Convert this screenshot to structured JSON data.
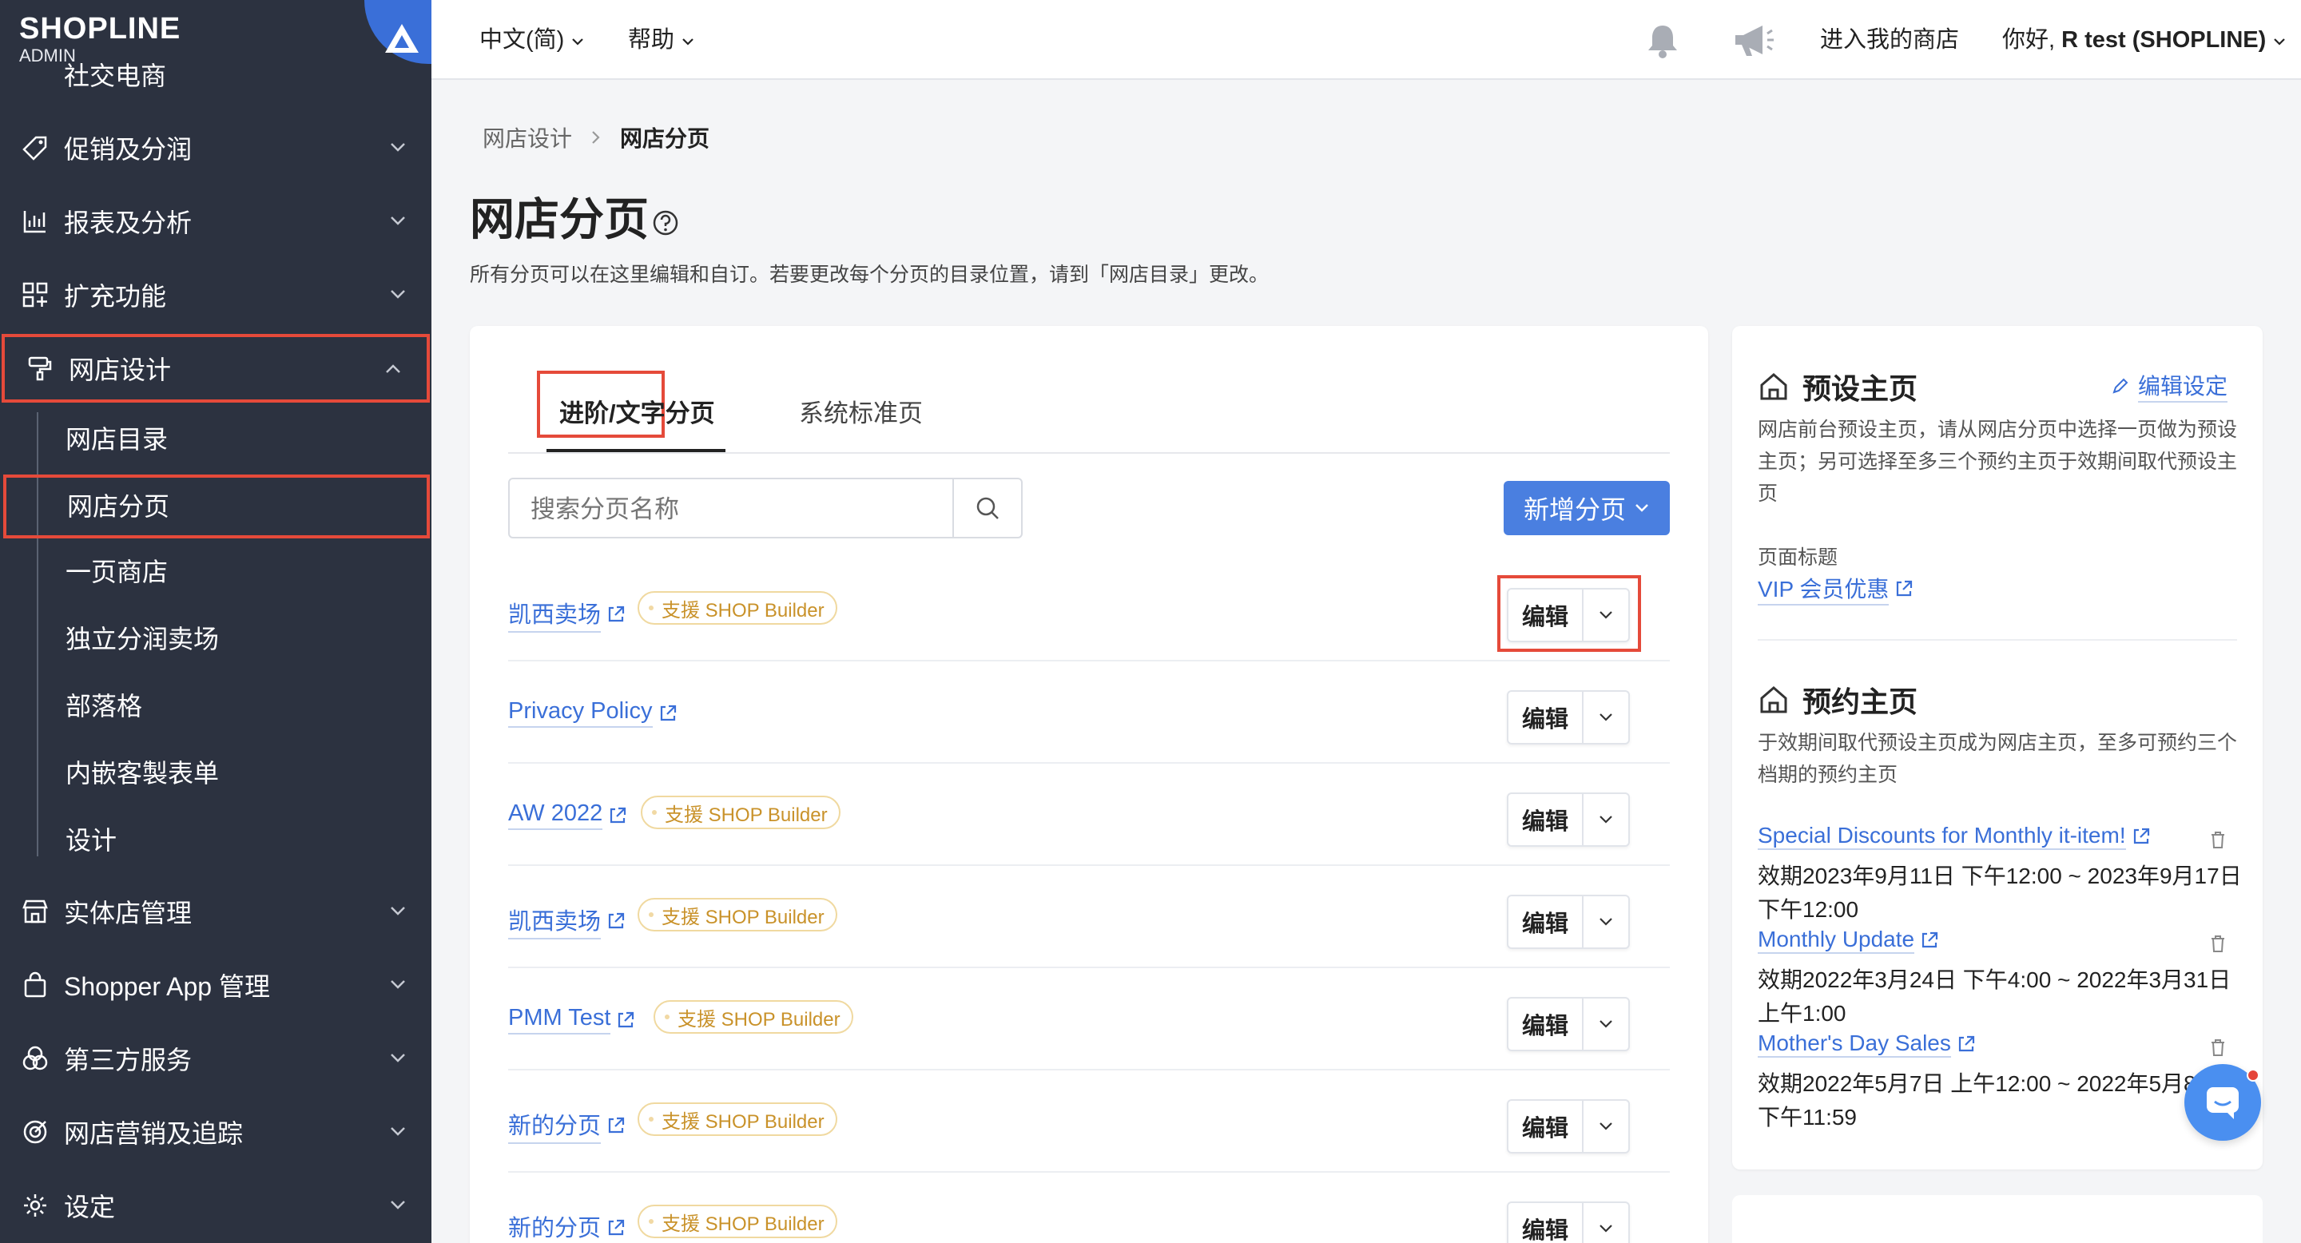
{
  "app": {
    "brand": "SHOPLINE",
    "brand_sub": "ADMIN"
  },
  "sidebar": {
    "cut_off_item": "社交电商",
    "items": [
      {
        "label": "促销及分润",
        "icon": "tag-icon"
      },
      {
        "label": "报表及分析",
        "icon": "chart-icon"
      },
      {
        "label": "扩充功能",
        "icon": "grid-icon"
      },
      {
        "label": "网店设计",
        "icon": "brush-icon"
      },
      {
        "label": "实体店管理",
        "icon": "store-icon"
      },
      {
        "label": "Shopper App 管理",
        "icon": "bag-icon"
      },
      {
        "label": "第三方服务",
        "icon": "circles-icon"
      },
      {
        "label": "网店营销及追踪",
        "icon": "target-icon"
      },
      {
        "label": "设定",
        "icon": "gear-icon"
      }
    ],
    "submenu": [
      "网店目录",
      "网店分页",
      "一页商店",
      "独立分润卖场",
      "部落格",
      "内嵌客製表单",
      "设计"
    ]
  },
  "topbar": {
    "language": "中文(简)",
    "help": "帮助",
    "enter_store": "进入我的商店",
    "greeting": "你好,",
    "user": "R test (SHOPLINE)"
  },
  "breadcrumb": {
    "parent": "网店设计",
    "current": "网店分页"
  },
  "page": {
    "title": "网店分页",
    "description": "所有分页可以在这里编辑和自订。若要更改每个分页的目录位置，请到「网店目录」更改。"
  },
  "tabs": {
    "active": "进阶/文字分页",
    "other": "系统标准页"
  },
  "search": {
    "placeholder": "搜索分页名称"
  },
  "add_page_label": "新增分页",
  "edit_label": "编辑",
  "pages": [
    {
      "name": "凯西卖场",
      "badge": "支援 SHOP Builder"
    },
    {
      "name": "Privacy Policy",
      "badge": ""
    },
    {
      "name": "AW 2022",
      "badge": "支援 SHOP Builder"
    },
    {
      "name": "凯西卖场",
      "badge": "支援 SHOP Builder"
    },
    {
      "name": "PMM Test",
      "badge": "支援 SHOP Builder"
    },
    {
      "name": "新的分页",
      "badge": "支援 SHOP Builder"
    },
    {
      "name": "新的分页",
      "badge": "支援 SHOP Builder"
    }
  ],
  "right_panel": {
    "default_home": {
      "title": "预设主页",
      "edit_label": "编辑设定",
      "description": "网店前台预设主页，请从网店分页中选择一页做为预设主页；另可选择至多三个预约主页于效期间取代预设主页",
      "page_title_label": "页面标题",
      "page_title_value": "VIP 会员优惠"
    },
    "scheduled_home": {
      "title": "预约主页",
      "description": "于效期间取代预设主页成为网店主页，至多可预约三个档期的预约主页",
      "items": [
        {
          "name": "Special Discounts for Monthly it-item!",
          "period": "效期2023年9月11日 下午12:00 ~ 2023年9月17日 下午12:00"
        },
        {
          "name": "Monthly Update",
          "period": "效期2022年3月24日 下午4:00 ~ 2022年3月31日 上午1:00"
        },
        {
          "name": "Mother's Day Sales",
          "period": "效期2022年5月7日 上午12:00 ~ 2022年5月8日 下午11:59"
        }
      ]
    }
  },
  "colors": {
    "sidebar_bg": "#2c3240",
    "accent": "#4a7fe0",
    "link": "#3a6fd8",
    "highlight": "#e54a3a",
    "badge": "#c9922a"
  }
}
